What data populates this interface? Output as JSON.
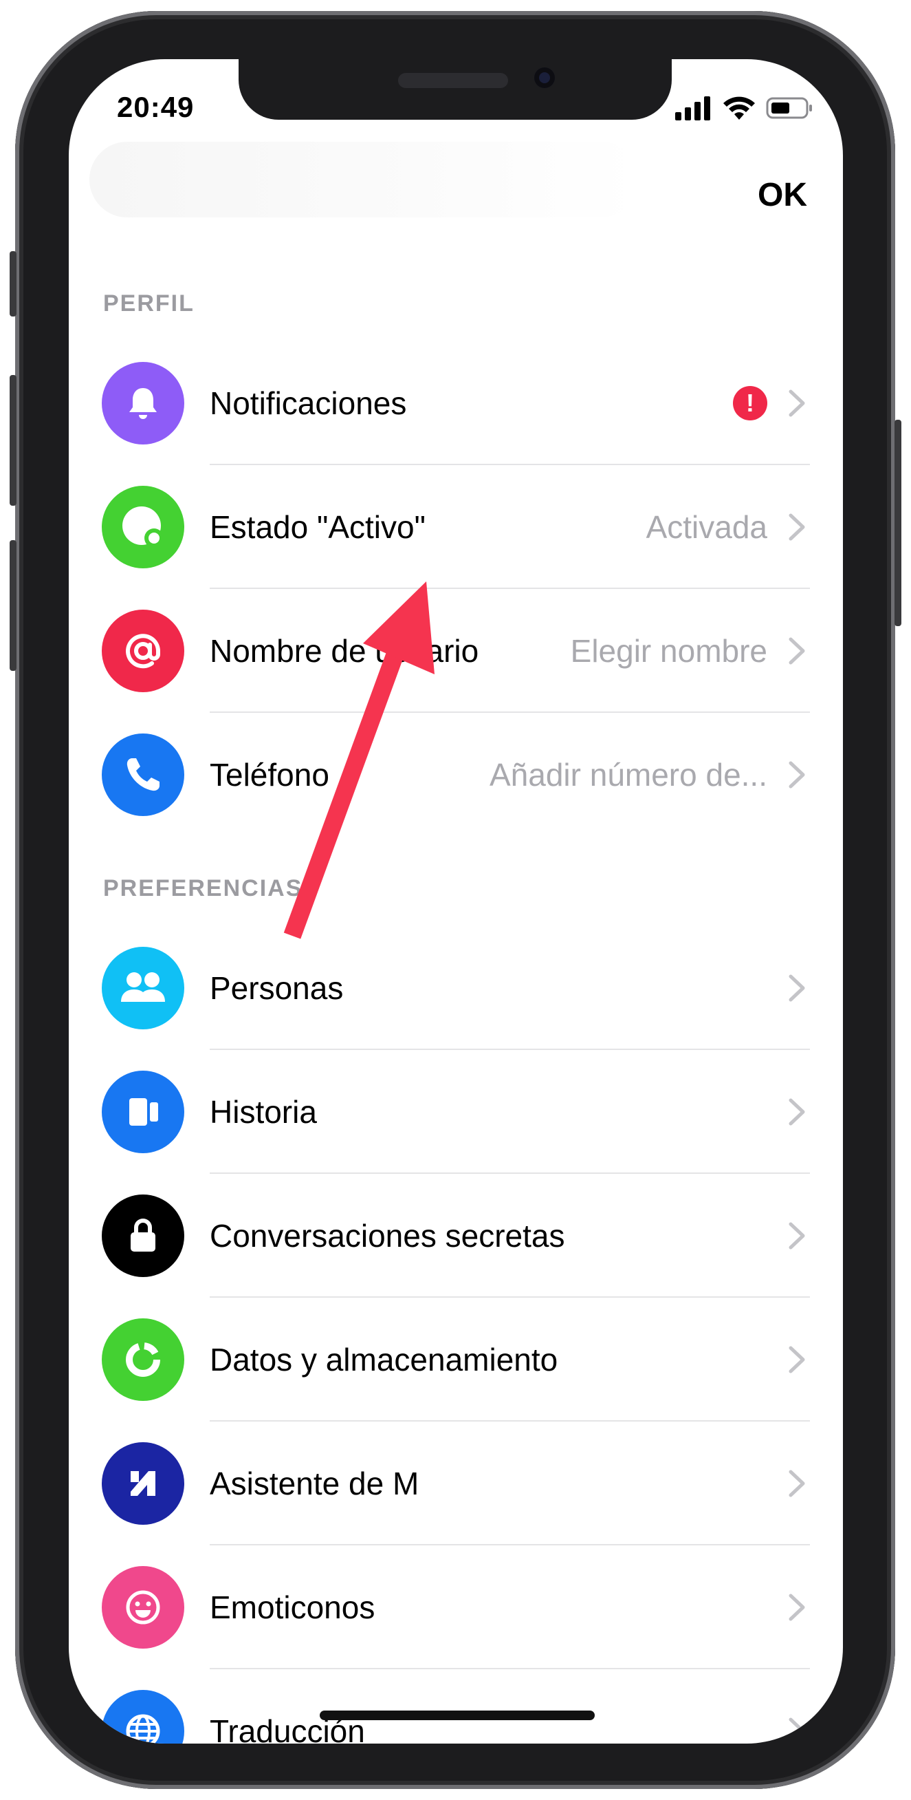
{
  "status_bar": {
    "time": "20:49"
  },
  "header": {
    "ok_label": "OK"
  },
  "sections": {
    "perfil": "PERFIL",
    "preferencias": "PREFERENCIAS"
  },
  "rows": [
    {
      "label": "Notificaciones",
      "value": "",
      "alert": "!",
      "icon": "bell-icon",
      "color": "#8e5cf7"
    },
    {
      "label": "Estado \"Activo\"",
      "value": "Activada",
      "icon": "active-status-icon",
      "color": "#44d132"
    },
    {
      "label": "Nombre de usuario",
      "value": "Elegir nombre",
      "icon": "at-sign-icon",
      "color": "#f0284a"
    },
    {
      "label": "Teléfono",
      "value": "Añadir número de...",
      "icon": "phone-icon",
      "color": "#1877f2"
    },
    {
      "label": "Personas",
      "value": "",
      "icon": "people-icon",
      "color": "#10c0f5"
    },
    {
      "label": "Historia",
      "value": "",
      "icon": "story-icon",
      "color": "#1877f2"
    },
    {
      "label": "Conversaciones secretas",
      "value": "",
      "icon": "lock-icon",
      "color": "#000000"
    },
    {
      "label": "Datos y almacenamiento",
      "value": "",
      "icon": "data-storage-icon",
      "color": "#44d132"
    },
    {
      "label": "Asistente de M",
      "value": "",
      "icon": "m-assistant-icon",
      "color": "#1b25a3"
    },
    {
      "label": "Emoticonos",
      "value": "",
      "icon": "emoji-icon",
      "color": "#f0488c"
    },
    {
      "label": "Traducción",
      "value": "",
      "icon": "globe-icon",
      "color": "#1877f2"
    }
  ],
  "annotation": {
    "arrow_color": "#f5344f"
  }
}
